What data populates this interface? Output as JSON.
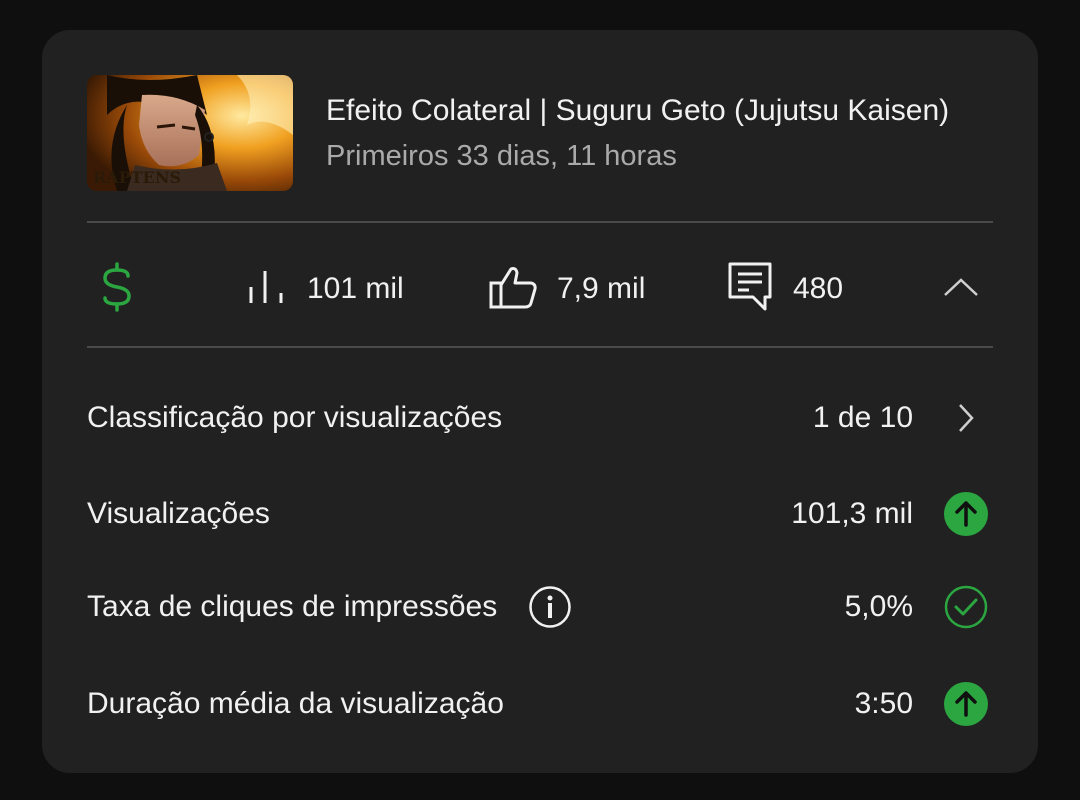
{
  "video": {
    "title": "Efeito Colateral | Suguru Geto (Jujutsu Kaisen)",
    "subtitle": "Primeiros 33 dias, 11 horas",
    "thumbnail_text": "RAPTENS"
  },
  "stats": {
    "monetization_icon": "dollar-icon",
    "views_icon": "bar-chart-icon",
    "views": "101 mil",
    "likes_icon": "thumbs-up-icon",
    "likes": "7,9 mil",
    "comments_icon": "comment-icon",
    "comments": "480",
    "collapse_icon": "chevron-up-icon"
  },
  "metrics": [
    {
      "label": "Classificação por visualizações",
      "value": "1 de 10",
      "icon": "chevron-right-icon"
    },
    {
      "label": "Visualizações",
      "value": "101,3 mil",
      "icon": "arrow-up-circle-icon"
    },
    {
      "label": "Taxa de cliques de impressões",
      "value": "5,0%",
      "icon": "check-circle-icon",
      "info_icon": "info-icon"
    },
    {
      "label": "Duração média da visualização",
      "value": "3:50",
      "icon": "arrow-up-circle-icon"
    }
  ],
  "colors": {
    "card_background": "#212121",
    "page_background": "#0f0f0f",
    "accent_green": "#2ba640",
    "text_primary": "#f1f1f1",
    "text_secondary": "#aaaaaa",
    "divider": "#4a4a4a"
  }
}
